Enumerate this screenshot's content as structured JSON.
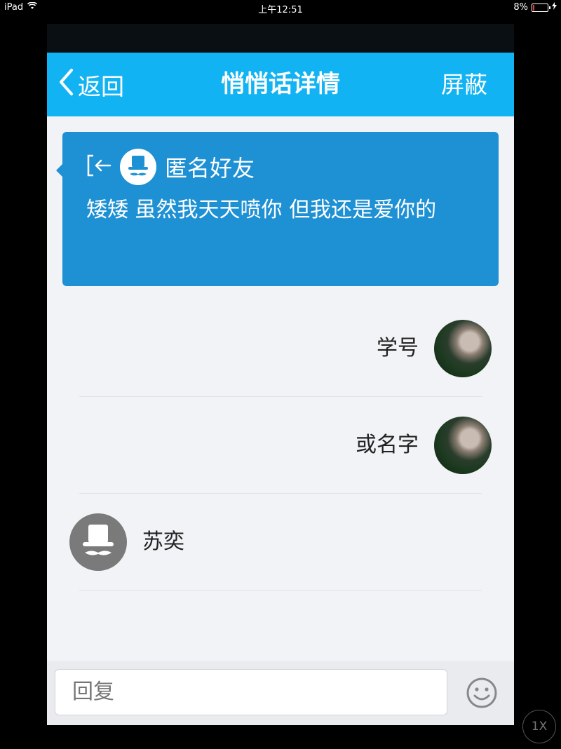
{
  "status_bar": {
    "device": "iPad",
    "time": "上午12:51",
    "battery": "8%"
  },
  "nav": {
    "back_label": "返回",
    "title": "悄悄话详情",
    "right_action": "屏蔽"
  },
  "message": {
    "sender": "匿名好友",
    "text": "矮矮 虽然我天天喷你 但我还是爱你的"
  },
  "replies": [
    {
      "text": "学号",
      "side": "right",
      "avatar": "photo-avatar"
    },
    {
      "text": "或名字",
      "side": "right",
      "avatar": "photo-avatar"
    },
    {
      "text": "苏奕",
      "side": "left",
      "avatar": "anonymous-avatar"
    }
  ],
  "reply_bar": {
    "placeholder": "回复"
  },
  "overlay": {
    "zoom_label": "1X"
  },
  "colors": {
    "nav_bg": "#12b3f2",
    "card_bg": "#1e90d4",
    "page_bg": "#f1f3f6"
  }
}
